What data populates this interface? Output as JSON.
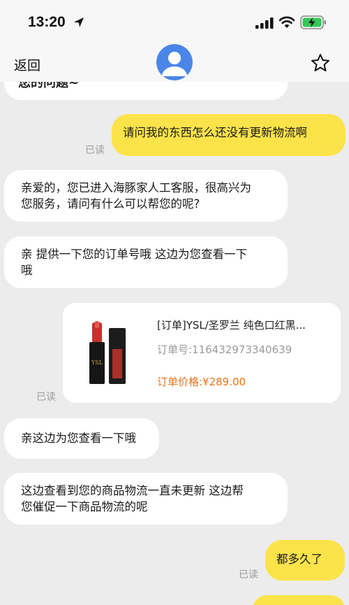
{
  "status_bar": {
    "time": "13:20"
  },
  "nav": {
    "back_label": "返回"
  },
  "messages": {
    "top_partial": "您的问题~",
    "m1": "请问我的东西怎么还没有更新物流啊",
    "m1_read": "已读",
    "m2_line1": "亲爱的，您已进入海豚家人工客服，很高兴为",
    "m2_line2": "您服务，请问有什么可以帮您的呢?",
    "m3_line1": "亲  提供一下您的订单号哦 这边为您查看一下",
    "m3_line2": "哦",
    "order_read": "已读",
    "m4": "亲这边为您查看一下哦",
    "m5_line1": "这边查看到您的商品物流一直未更新 这边帮",
    "m5_line2": "您催促一下商品物流的呢",
    "m6": "都多久了",
    "m6_read": "已读"
  },
  "order": {
    "title": "[订单]YSL/圣罗兰  纯色口红黑...",
    "number": "订单号:116432973340639",
    "price": "订单价格:¥289.00"
  },
  "colors": {
    "user_bubble": "#fce34a",
    "agent_bubble": "#ffffff",
    "background": "#ececec",
    "price": "#e8741c",
    "avatar": "#4a86e8"
  },
  "icons": {
    "location": "location-arrow-icon",
    "signal": "cellular-signal-icon",
    "wifi": "wifi-icon",
    "battery": "battery-charging-icon",
    "avatar": "user-avatar-icon",
    "favorite": "star-outline-icon"
  }
}
